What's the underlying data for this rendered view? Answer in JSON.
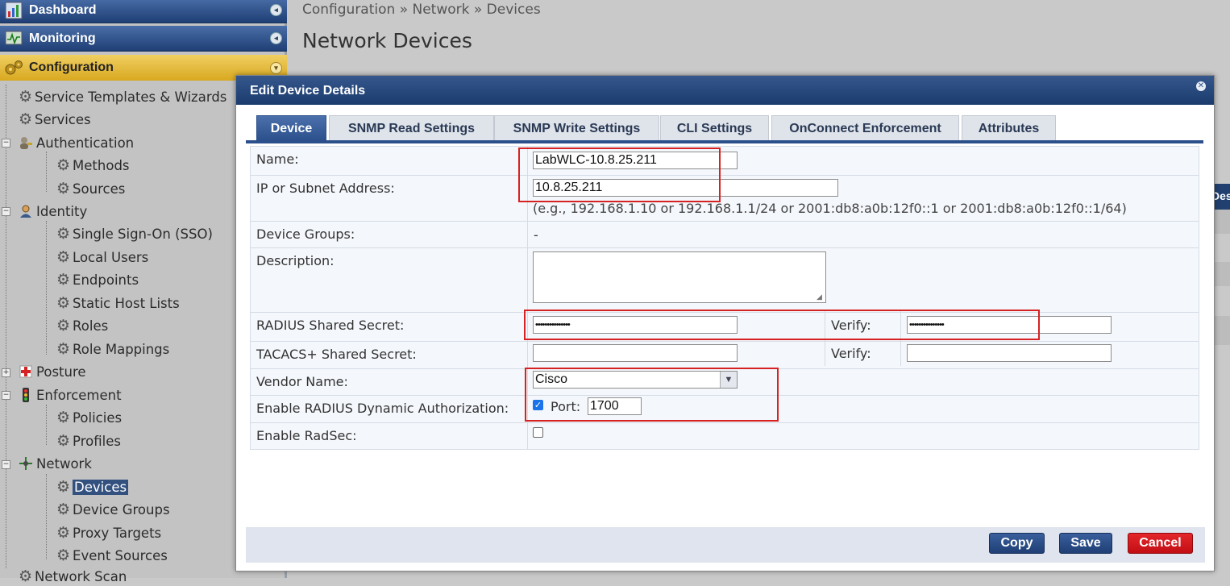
{
  "nav": {
    "dashboard": "Dashboard",
    "monitoring": "Monitoring",
    "configuration": "Configuration",
    "items": {
      "service_templates": "Service Templates & Wizards",
      "services": "Services",
      "authentication": "Authentication",
      "methods": "Methods",
      "sources": "Sources",
      "identity": "Identity",
      "sso": "Single Sign-On (SSO)",
      "local_users": "Local Users",
      "endpoints": "Endpoints",
      "static_host_lists": "Static Host Lists",
      "roles": "Roles",
      "role_mappings": "Role Mappings",
      "posture": "Posture",
      "enforcement": "Enforcement",
      "policies": "Policies",
      "profiles": "Profiles",
      "network": "Network",
      "devices": "Devices",
      "device_groups": "Device Groups",
      "proxy_targets": "Proxy Targets",
      "event_sources": "Event Sources",
      "network_scan": "Network Scan"
    }
  },
  "breadcrumb": "Configuration » Network » Devices",
  "page_title": "Network Devices",
  "modal": {
    "title": "Edit Device Details",
    "tabs": [
      "Device",
      "SNMP Read Settings",
      "SNMP Write Settings",
      "CLI Settings",
      "OnConnect Enforcement",
      "Attributes"
    ],
    "fields": {
      "name_label": "Name:",
      "name_value": "LabWLC-10.8.25.211",
      "ip_label": "IP or Subnet Address:",
      "ip_value": "10.8.25.211",
      "ip_hint": "(e.g., 192.168.1.10 or 192.168.1.1/24 or 2001:db8:a0b:12f0::1 or 2001:db8:a0b:12f0::1/64)",
      "groups_label": "Device Groups:",
      "groups_value": "-",
      "desc_label": "Description:",
      "desc_value": "",
      "radius_label": "RADIUS Shared Secret:",
      "radius_value": "•••••••••••••••",
      "verify_label": "Verify:",
      "radius_verify_value": "•••••••••••••••",
      "tacacs_label": "TACACS+ Shared Secret:",
      "tacacs_value": "",
      "tacacs_verify_value": "",
      "vendor_label": "Vendor Name:",
      "vendor_value": "Cisco",
      "coa_label": "Enable RADIUS Dynamic Authorization:",
      "coa_checked": true,
      "port_label": "Port:",
      "port_value": "1700",
      "radsec_label": "Enable RadSec:",
      "radsec_checked": false
    },
    "buttons": {
      "copy": "Copy",
      "save": "Save",
      "cancel": "Cancel"
    }
  },
  "colors": {
    "nav_blue": "#1f3f75",
    "config_gold": "#d8a81f",
    "cancel_red": "#c20f14",
    "highlight_red": "#d62222"
  }
}
